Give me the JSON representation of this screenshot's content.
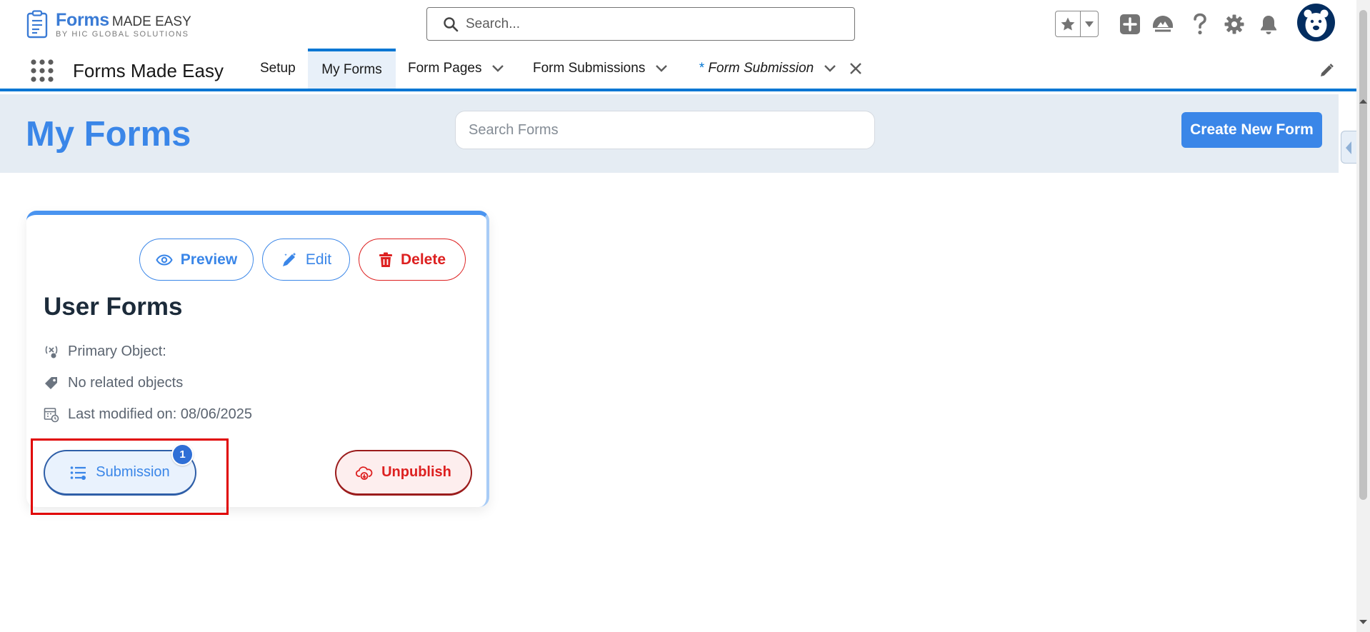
{
  "header": {
    "logo": {
      "brand": "Forms",
      "sub": "MADE EASY",
      "tagline": "BY HIC GLOBAL SOLUTIONS"
    },
    "search": {
      "placeholder": "Search..."
    },
    "utility_icons": [
      "favorites-star-icon",
      "favorites-menu-icon",
      "add-icon",
      "trailhead-icon",
      "help-icon",
      "setup-gear-icon",
      "notifications-bell-icon",
      "avatar"
    ]
  },
  "nav": {
    "app_name": "Forms Made Easy",
    "items": [
      {
        "label": "Setup",
        "active": false,
        "has_menu": false
      },
      {
        "label": "My Forms",
        "active": true,
        "has_menu": false
      },
      {
        "label": "Form Pages",
        "active": false,
        "has_menu": true
      },
      {
        "label": "Form Submissions",
        "active": false,
        "has_menu": true
      },
      {
        "label": "Form Submission",
        "active": false,
        "has_menu": true,
        "dirty_marker": "*",
        "italic": true,
        "closable": true
      }
    ]
  },
  "page": {
    "title": "My Forms",
    "search_placeholder": "Search Forms",
    "create_label": "Create New Form"
  },
  "card": {
    "actions": {
      "preview": "Preview",
      "edit": "Edit",
      "delete": "Delete"
    },
    "title": "User Forms",
    "meta": {
      "primary_object": "Primary Object:",
      "related": "No related objects",
      "modified": "Last modified on: 08/06/2025"
    },
    "submission_label": "Submission",
    "submission_count": "1",
    "unpublish_label": "Unpublish"
  },
  "colors": {
    "brand_blue": "#3a86e8",
    "nav_accent": "#0176d3",
    "danger_red": "#dd2020",
    "highlight_red": "#e00000",
    "header_band": "#e5ecf3"
  }
}
